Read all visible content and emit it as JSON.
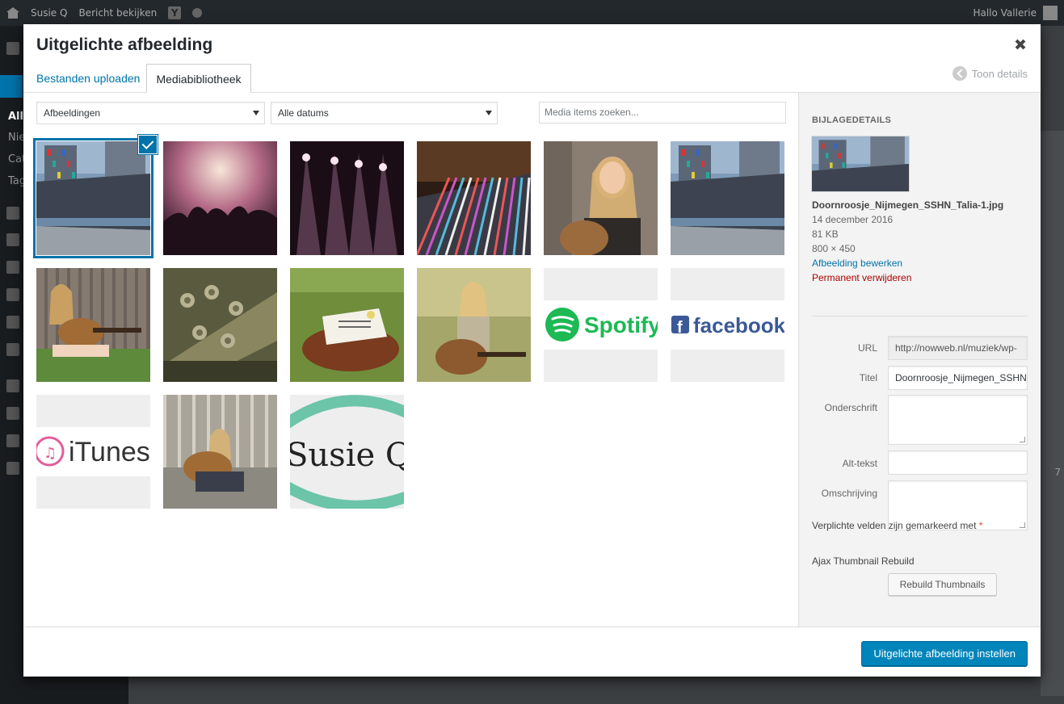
{
  "adminbar": {
    "site_name": "Susie Q",
    "view_post": "Bericht bekijken",
    "yoast_letter": "Y",
    "greeting": "Hallo Vallerie"
  },
  "sidemenu": {
    "sub_items": [
      "Alle",
      "Nie",
      "Cat",
      "Tag"
    ],
    "ghost_number": "7"
  },
  "modal": {
    "title": "Uitgelichte afbeelding",
    "tabs": [
      {
        "label": "Bestanden uploaden",
        "active": false
      },
      {
        "label": "Mediabibliotheek",
        "active": true
      }
    ],
    "toon_details": "Toon details",
    "filters": {
      "type_selected": "Afbeeldingen",
      "date_selected": "Alle datums",
      "search_placeholder": "Media items zoeken..."
    },
    "grid": {
      "selected_index": 0,
      "items": [
        {
          "kind": "building"
        },
        {
          "kind": "concert-crowd"
        },
        {
          "kind": "stage-lights"
        },
        {
          "kind": "mixing-desk"
        },
        {
          "kind": "girl-guitar-smile"
        },
        {
          "kind": "building"
        },
        {
          "kind": "girl-guitar-fence"
        },
        {
          "kind": "guitar-headstock"
        },
        {
          "kind": "sheet-music-bag"
        },
        {
          "kind": "girl-guitar-field"
        },
        {
          "kind": "logo",
          "text": "Spotify",
          "color": "#1db954"
        },
        {
          "kind": "logo",
          "text": "facebook",
          "color": "#3b5998"
        },
        {
          "kind": "logo",
          "text": "iTunes",
          "color": "#333333"
        },
        {
          "kind": "girl-guitar-bridge"
        },
        {
          "kind": "logo-susie",
          "text": "Susie Q",
          "color": "#6cc4a9"
        }
      ]
    },
    "details": {
      "heading": "BIJLAGEDETAILS",
      "filename": "Doornroosje_Nijmegen_SSHN_Talia-1.jpg",
      "date": "14 december 2016",
      "size": "81 KB",
      "dimensions": "800 × 450",
      "edit_link": "Afbeelding bewerken",
      "delete_link": "Permanent verwijderen",
      "fields": {
        "url_label": "URL",
        "url_value": "http://nowweb.nl/muziek/wp-",
        "title_label": "Titel",
        "title_value": "Doornroosje_Nijmegen_SSHN",
        "caption_label": "Onderschrift",
        "alt_label": "Alt-tekst",
        "description_label": "Omschrijving"
      },
      "required_note": "Verplichte velden zijn gemarkeerd met",
      "required_star": "*",
      "ajax_label": "Ajax Thumbnail Rebuild",
      "rebuild_button": "Rebuild Thumbnails"
    },
    "footer": {
      "primary_button": "Uitgelichte afbeelding instellen"
    }
  }
}
